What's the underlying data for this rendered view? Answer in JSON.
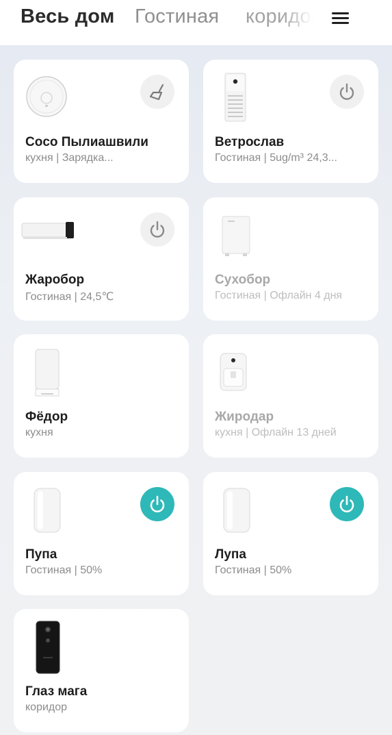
{
  "tabs": [
    "Весь дом",
    "Гостиная",
    "коридор"
  ],
  "devices": [
    {
      "name": "Coco Пылиашвили",
      "status": "кухня | Зарядка...",
      "icon": "robot-vacuum-icon",
      "action": "broom-icon"
    },
    {
      "name": "Ветрослав",
      "status": "Гостиная | 5ug/m³ 24,3...",
      "icon": "air-purifier-icon",
      "action": "power-icon"
    },
    {
      "name": "Жаробор",
      "status": "Гостиная | 24,5℃",
      "icon": "heater-icon",
      "action": "power-icon"
    },
    {
      "name": "Сухобор",
      "status": "Гостиная | Офлайн 4 дня",
      "icon": "dehumidifier-icon",
      "offline": true
    },
    {
      "name": "Фёдор",
      "status": "кухня",
      "icon": "water-dispenser-icon"
    },
    {
      "name": "Жиродар",
      "status": "кухня | Офлайн 13 дней",
      "icon": "air-fryer-icon",
      "offline": true
    },
    {
      "name": "Пупа",
      "status": "Гостиная | 50%",
      "icon": "humidifier-icon",
      "action": "power-icon",
      "power_on": true
    },
    {
      "name": "Лупа",
      "status": "Гостиная | 50%",
      "icon": "humidifier-icon",
      "action": "power-icon",
      "power_on": true
    },
    {
      "name": "Глаз мага",
      "status": "коридор",
      "icon": "video-doorbell-icon"
    }
  ],
  "colors": {
    "accent": "#2fb8b8",
    "card": "#ffffff",
    "text": "#1d1d1d",
    "muted": "#8c8c8c"
  }
}
